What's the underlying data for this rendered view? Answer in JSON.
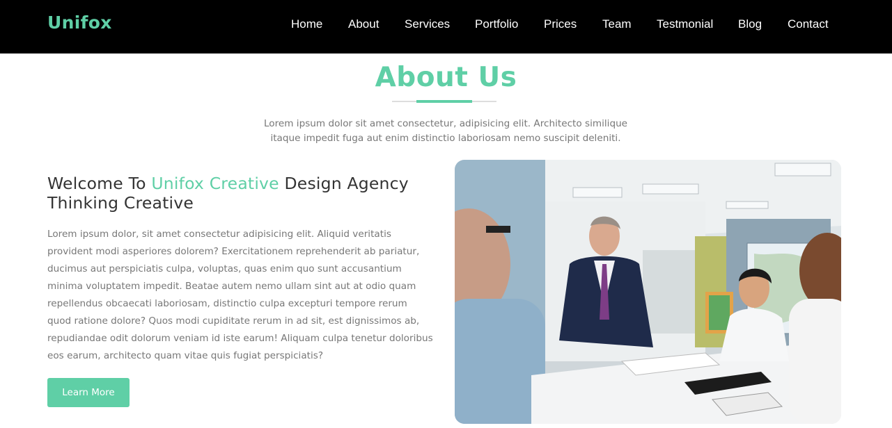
{
  "header": {
    "brand": "Unifox",
    "nav": [
      "Home",
      "About",
      "Services",
      "Portfolio",
      "Prices",
      "Team",
      "Testmonial",
      "Blog",
      "Contact"
    ]
  },
  "about": {
    "title": "About Us",
    "subtitle_line1": "Lorem ipsum dolor sit amet consectetur, adipisicing elit. Architecto similique",
    "subtitle_line2": "itaque impedit fuga aut enim distinctio laboriosam nemo suscipit deleniti.",
    "heading_part1": "Welcome To ",
    "heading_accent": "Unifox Creative",
    "heading_part2": " Design Agency",
    "heading_line2": "Thinking Creative",
    "body_lines": [
      "Lorem ipsum dolor, sit amet consectetur adipisicing elit. Aliquid veritatis",
      "provident modi asperiores dolorem? Exercitationem reprehenderit ab pariatur,",
      "ducimus aut perspiciatis culpa, voluptas, quas enim quo sunt accusantium",
      "minima voluptatem impedit. Beatae autem nemo ullam sint aut at odio quam",
      "repellendus obcaecati laboriosam, distinctio culpa excepturi tempore rerum",
      "quod ratione dolore? Quos modi cupiditate rerum in ad sit, est dignissimos ab,",
      "repudiandae odit dolorum veniam id iste earum! Aliquam culpa tenetur doloribus",
      "eos earum, architecto quam vitae quis fugiat perspiciatis?"
    ],
    "button_label": "Learn More"
  },
  "colors": {
    "accent": "#5fcfa6",
    "header_bg": "#000000",
    "text": "#333333",
    "muted": "#777777"
  }
}
